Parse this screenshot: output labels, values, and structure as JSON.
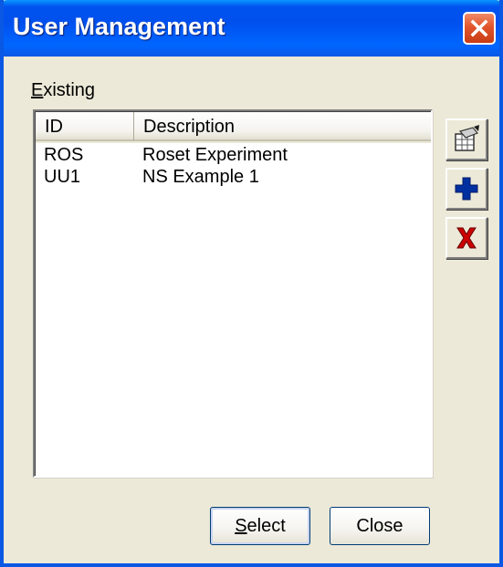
{
  "window": {
    "title": "User Management"
  },
  "existing_group": {
    "label_mnemonic": "E",
    "label_rest": "xisting"
  },
  "table": {
    "columns": [
      "ID",
      "Description"
    ],
    "rows": [
      {
        "id": "ROS",
        "description": "Roset Experiment"
      },
      {
        "id": "UU1",
        "description": "NS Example 1"
      }
    ]
  },
  "toolbar": {
    "edit_icon": "edit-table-icon",
    "add_icon": "add-plus-icon",
    "delete_icon": "delete-x-icon"
  },
  "buttons": {
    "select_mnemonic": "S",
    "select_rest": "elect",
    "close_label": "Close"
  },
  "colors": {
    "title_bar": "#0053ee",
    "close_button": "#e2552c",
    "dialog_face": "#ece9d8",
    "add_icon": "#0030a0",
    "delete_icon": "#cc0000"
  }
}
